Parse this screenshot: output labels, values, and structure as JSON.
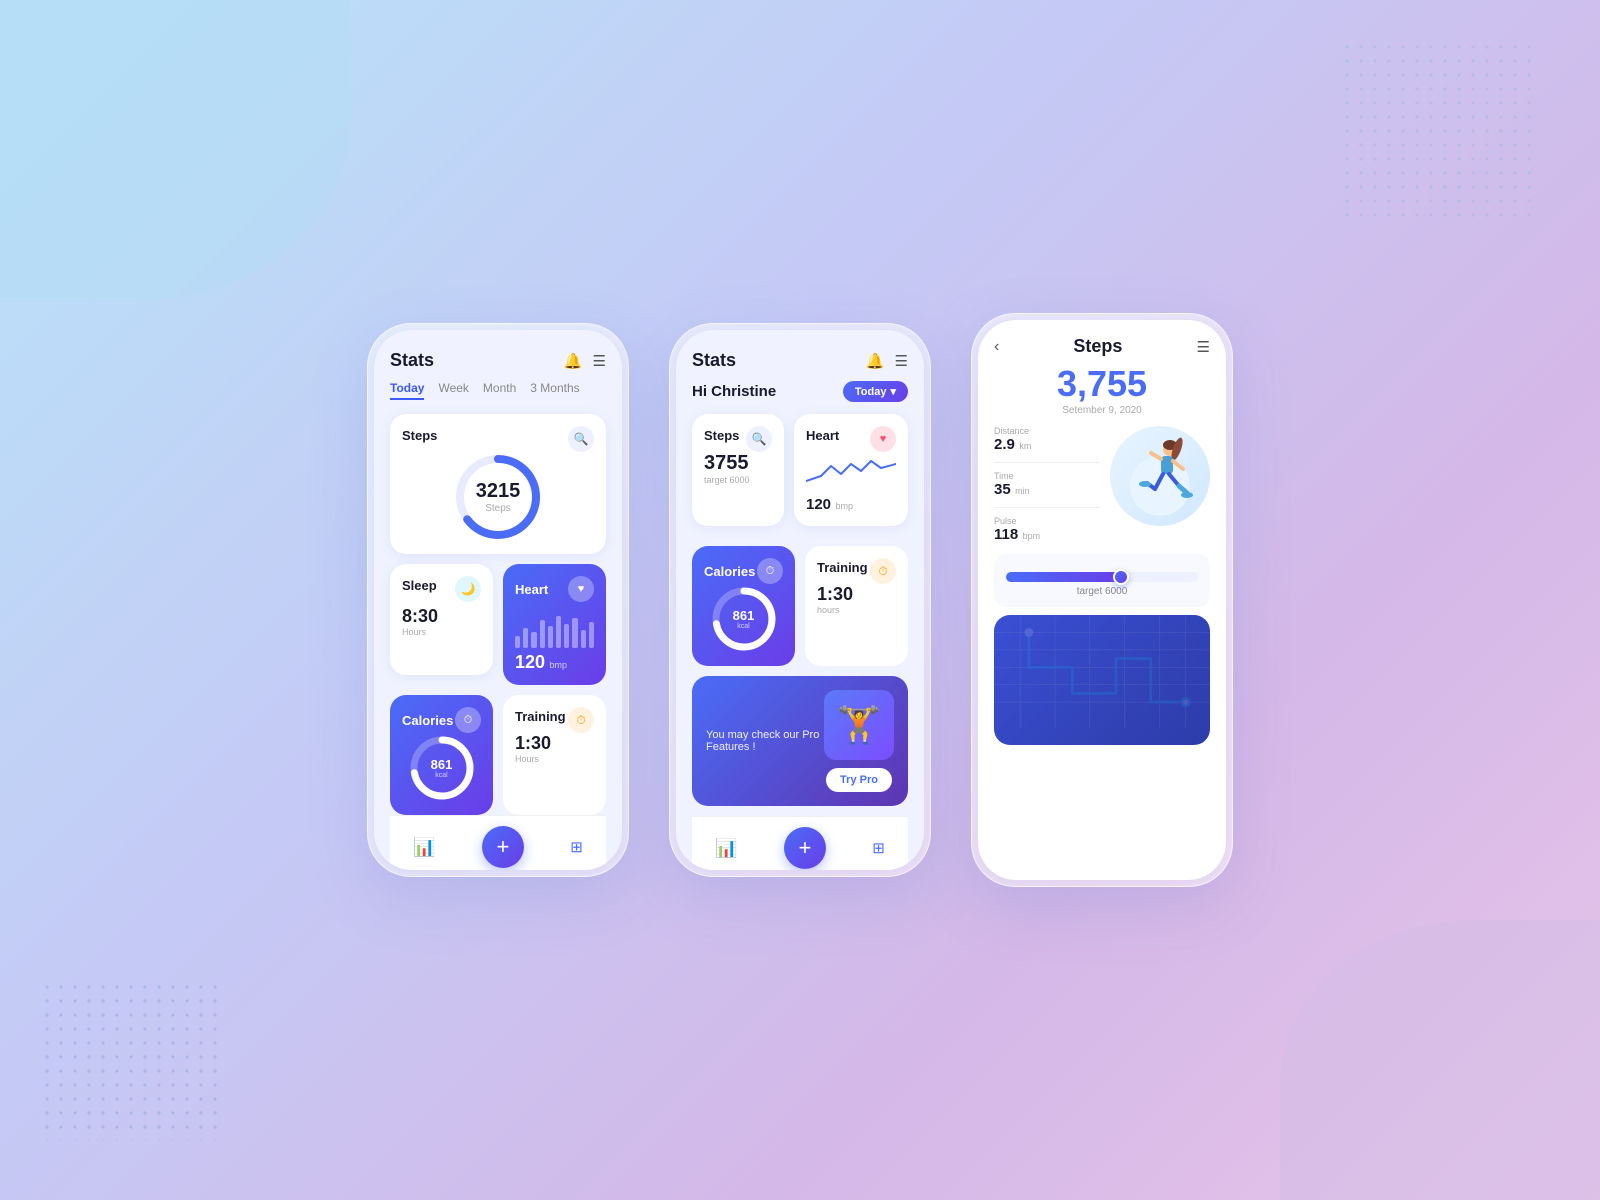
{
  "background": {
    "gradient": "linear-gradient(135deg, #b8e4f9 0%, #c5c9f5 40%, #d4b8e8 70%, #e8c4e8 100%)"
  },
  "phone1": {
    "title": "Stats",
    "tabs": [
      "Today",
      "Week",
      "Month",
      "3 Months"
    ],
    "active_tab": "Today",
    "steps_card": {
      "label": "Steps",
      "value": "3215",
      "unit": "Steps",
      "progress": 65
    },
    "sleep_card": {
      "label": "Sleep",
      "value": "8:30",
      "unit": "Hours"
    },
    "heart_card": {
      "label": "Heart",
      "value": "120",
      "unit": "bmp",
      "bars": [
        30,
        50,
        40,
        70,
        55,
        80,
        60,
        75,
        45,
        65
      ]
    },
    "calories_card": {
      "label": "Calories",
      "value": "861",
      "unit": "kcal",
      "progress": 72
    },
    "training_card": {
      "label": "Training",
      "value": "1:30",
      "unit": "Hours"
    },
    "nav": {
      "chart_label": "chart",
      "plus_label": "+",
      "menu_label": "menu"
    }
  },
  "phone2": {
    "title": "Stats",
    "greeting": "Hi Christine",
    "period_badge": "Today",
    "steps_card": {
      "label": "Steps",
      "value": "3755",
      "target": "target 6000"
    },
    "heart_card": {
      "label": "Heart",
      "value": "120",
      "unit": "bmp"
    },
    "calories_card": {
      "label": "Calories",
      "value": "861",
      "unit": "kcal",
      "progress": 72
    },
    "training_card": {
      "label": "Training",
      "value": "1:30",
      "unit": "hours"
    },
    "promo_card": {
      "text": "You may check our Pro Features !",
      "button": "Try Pro"
    }
  },
  "phone3": {
    "title": "Steps",
    "steps_value": "3,755",
    "date": "Setember 9, 2020",
    "distance": {
      "label": "Distance",
      "value": "2.9",
      "unit": "km"
    },
    "time": {
      "label": "Time",
      "value": "35",
      "unit": "min"
    },
    "pulse": {
      "label": "Pulse",
      "value": "118",
      "unit": "bpm"
    },
    "progress": {
      "value": 62,
      "target": "target 6000"
    }
  }
}
